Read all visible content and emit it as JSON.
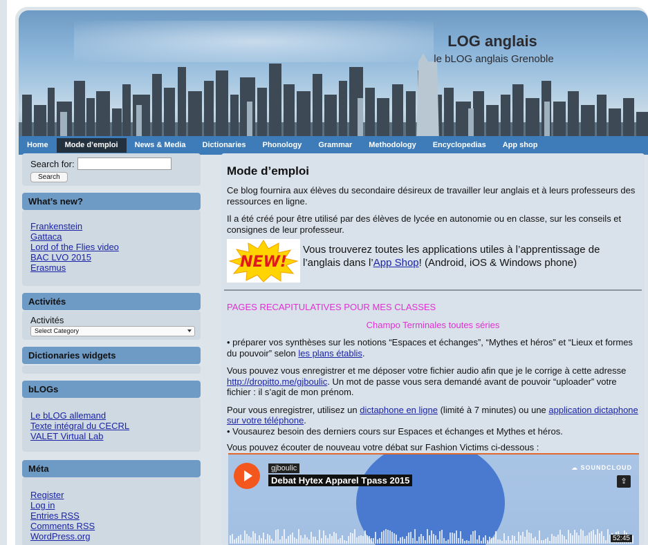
{
  "site": {
    "title": "LOG anglais",
    "subtitle": "le bLOG anglais Grenoble"
  },
  "nav": {
    "items": [
      {
        "label": "Home"
      },
      {
        "label": "Mode d’emploi"
      },
      {
        "label": "News & Media"
      },
      {
        "label": "Dictionaries"
      },
      {
        "label": "Phonology"
      },
      {
        "label": "Grammar"
      },
      {
        "label": "Methodology"
      },
      {
        "label": "Encyclopedias"
      },
      {
        "label": "App shop"
      }
    ],
    "active": "Mode d’emploi"
  },
  "search": {
    "label": "Search for:",
    "value": "",
    "button": "Search"
  },
  "whats_new": {
    "title": "What’s new?",
    "links": [
      "Frankenstein",
      "Gattaca",
      "Lord of the Flies video",
      "BAC LVO 2015",
      "Erasmus"
    ]
  },
  "activites": {
    "title": "Activités",
    "label": "Activités",
    "select_value": "Select Category"
  },
  "dictionaries_widgets": {
    "title": "Dictionaries widgets"
  },
  "blogs": {
    "title": "bLOGs",
    "links": [
      "Le bLOG allemand",
      "Texte intégral du CECRL",
      "VALET Virtual Lab"
    ]
  },
  "meta": {
    "title": "Méta",
    "links": [
      "Register",
      "Log in",
      "Entries RSS",
      "Comments RSS",
      "WordPress.org"
    ]
  },
  "main": {
    "heading": "Mode d’emploi",
    "p1": "Ce blog fournira aux élèves du secondaire désireux de travailler leur anglais et à leurs professeurs des ressources en ligne.",
    "p2": "Il a été créé pour être utilisé par des élèves de lycée en autonomie ou en classe, sur les conseils et consignes de leur professeur.",
    "new_badge": "NEW!",
    "p3_before": "Vous trouverez toutes les applications utiles à l’apprentissage de l’anglais dans l’",
    "p3_link": "App Shop",
    "p3_after": "! (Android, iOS & Windows phone)",
    "recap_title": "PAGES RECAPITULATIVES POUR MES CLASSES",
    "recap_sub": "Champo Terminales toutes séries",
    "p4_before": "• préparer vos synthèses sur les notions “Espaces et échanges”, “Mythes et héros” et “Lieux et formes du pouvoir” selon ",
    "p4_link": "les plans établis",
    "p4_after": ".",
    "p5_before": "Vous pouvez vous enregistrer et me déposer votre fichier audio afin que je le corrige à cette adresse ",
    "p5_link": "http://dropitto.me/gjboulic",
    "p5_after": ". Un mot de passe vous sera demandé avant de pouvoir “uploader” votre fichier : il s’agit de mon prénom.",
    "p6_before": "Pour vous enregistrer, utilisez un ",
    "p6_link1": "dictaphone en ligne",
    "p6_mid": " (limité à 7 minutes) ou une ",
    "p6_link2": "application dictaphone sur votre téléphone",
    "p6_after": ".",
    "p6_line2": "• Vousaurez besoin des derniers cours sur Espaces et échanges et Mythes et héros.",
    "p7": "Vous pouvez écouter de nouveau votre débat sur Fashion Victims ci-dessous :"
  },
  "player": {
    "user": "gjboulic",
    "track": "Debat Hytex Apparel Tpass 2015",
    "brand": "SOUNDCLOUD",
    "duration": "52:45",
    "colors": {
      "play": "#f3571d",
      "accent": "#e1682d"
    }
  }
}
